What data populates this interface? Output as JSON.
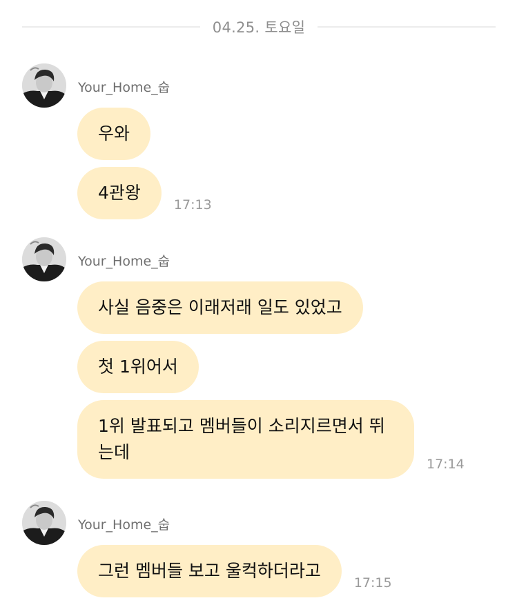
{
  "date_divider": "04.25. 토요일",
  "groups": [
    {
      "sender": "Your_Home_숩",
      "messages": [
        {
          "text": "우와",
          "time": ""
        },
        {
          "text": "4관왕",
          "time": "17:13"
        }
      ]
    },
    {
      "sender": "Your_Home_숩",
      "messages": [
        {
          "text": "사실 음중은 이래저래 일도 있었고",
          "time": ""
        },
        {
          "text": "첫 1위어서",
          "time": ""
        },
        {
          "text": "1위 발표되고 멤버들이 소리지르면서 뛰는데",
          "time": "17:14"
        }
      ]
    },
    {
      "sender": "Your_Home_숩",
      "messages": [
        {
          "text": "그런 멤버들 보고 울컥하더라고",
          "time": "17:15"
        }
      ]
    }
  ],
  "colors": {
    "bubble": "#ffeec6",
    "text": "#111111",
    "time": "#9a9a9a",
    "sender": "#6f6f6f",
    "divider": "#ececec"
  },
  "icons": {
    "avatar": "profile-photo-grayscale"
  }
}
